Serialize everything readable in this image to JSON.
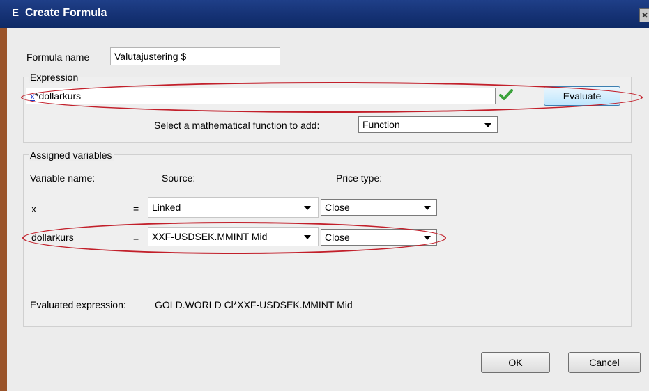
{
  "window": {
    "app_icon_letter": "E",
    "title": "Create Formula",
    "close_label": "✕"
  },
  "formula": {
    "name_label": "Formula name",
    "name_value": "Valutajustering $"
  },
  "expression": {
    "legend": "Expression",
    "input_var": "x",
    "input_rest": "*dollarkurs",
    "evaluate_label": "Evaluate",
    "function_prompt": "Select a mathematical function to add:",
    "function_value": "Function"
  },
  "variables": {
    "legend": "Assigned variables",
    "col_name": "Variable name:",
    "col_source": "Source:",
    "col_price": "Price type:",
    "rows": [
      {
        "name": "x",
        "eq": "=",
        "source": "Linked",
        "price": "Close"
      },
      {
        "name": "dollarkurs",
        "eq": "=",
        "source": "XXF-USDSEK.MMINT Mid",
        "price": "Close"
      }
    ],
    "evaluated_label": "Evaluated expression:",
    "evaluated_value": "GOLD.WORLD Cl*XXF-USDSEK.MMINT Mid"
  },
  "footer": {
    "ok_label": "OK",
    "cancel_label": "Cancel"
  },
  "colors": {
    "titlebar": "#163376",
    "highlight": "#c21f2a",
    "check": "#3aa13a"
  }
}
